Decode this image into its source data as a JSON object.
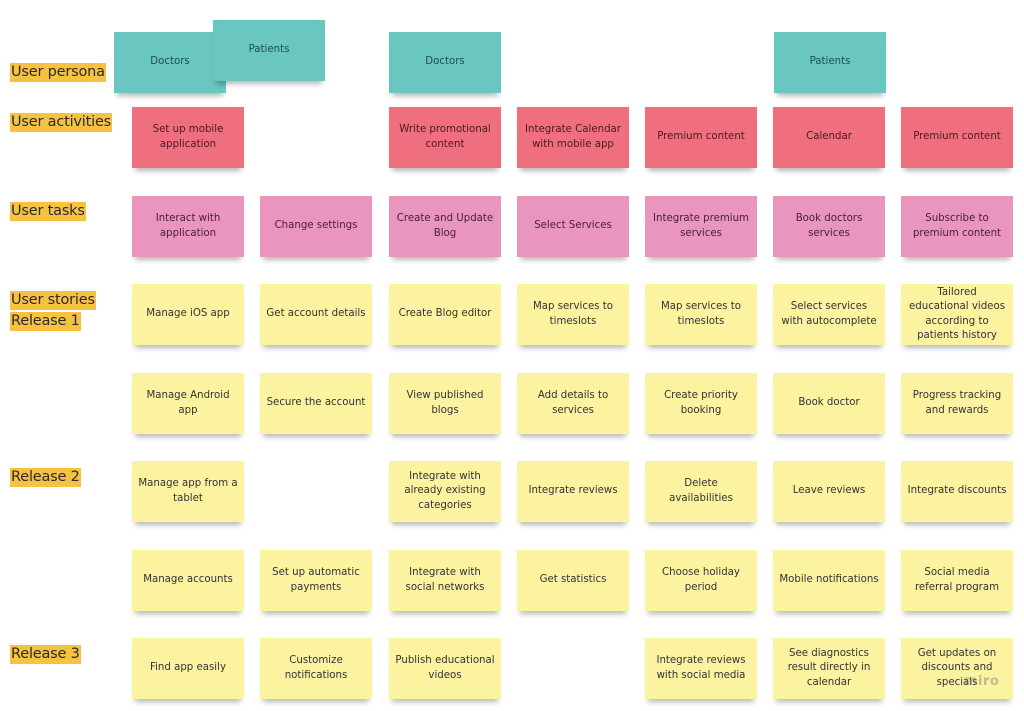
{
  "row_labels": {
    "user_persona": "User persona",
    "user_activities": "User activities",
    "user_tasks": "User tasks",
    "user_stories": "User stories",
    "release_1": "Release 1",
    "release_2": "Release 2",
    "release_3": "Release 3"
  },
  "colors": {
    "label_highlight": "#f7c242",
    "persona": "#6ac6c0",
    "activity": "#ef6f7f",
    "task": "#e995bd",
    "story": "#fbf3a0"
  },
  "personas": [
    "Doctors",
    "Patients",
    "Doctors",
    "Patients"
  ],
  "activities": [
    "Set up mobile application",
    "Write promotional content",
    "Integrate Calendar with mobile app",
    "Premium content",
    "Calendar",
    "Premium content"
  ],
  "tasks": [
    "Interact with application",
    "Change settings",
    "Create and Update Blog",
    "Select Services",
    "Integrate premium services",
    "Book doctors services",
    "Subscribe to premium content"
  ],
  "release1_row1": [
    "Manage iOS app",
    "Get account details",
    "Create Blog editor",
    "Map services to timeslots",
    "Map services to timeslots",
    "Select services with autocomplete",
    "Tailored educational videos according to patients history"
  ],
  "release1_row2": [
    "Manage Android app",
    "Secure the account",
    "View published blogs",
    "Add details to services",
    "Create priority booking",
    "Book doctor",
    "Progress tracking and rewards"
  ],
  "release2_row1": [
    "Manage app from a tablet",
    "Integrate with already existing categories",
    "Integrate reviews",
    "Delete availabilities",
    "Leave reviews",
    "Integrate discounts"
  ],
  "release2_row2": [
    "Manage accounts",
    "Set up automatic payments",
    "Integrate with social networks",
    "Get statistics",
    "Choose holiday period",
    "Mobile notifications",
    "Social media referral program"
  ],
  "release3_row1": [
    "Find app easily",
    "Customize notifications",
    "Publish educational videos",
    "Integrate reviews with social media",
    "See diagnostics result directly in calendar",
    "Get updates on discounts and specials"
  ],
  "watermark": "miro"
}
